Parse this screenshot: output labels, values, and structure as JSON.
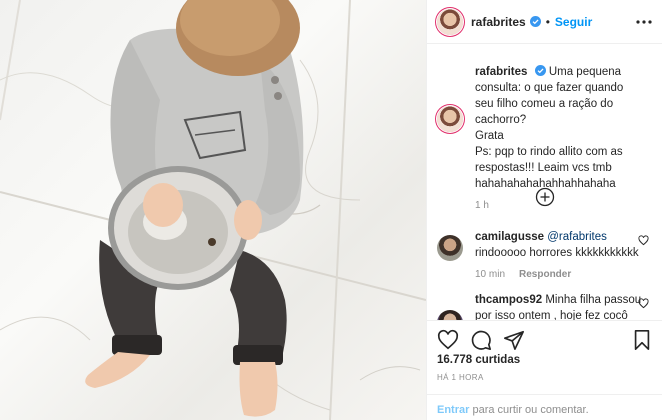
{
  "post": {
    "username": "rafabrites",
    "follow_label": "Seguir",
    "separator": "•",
    "photo_alt": "Criança sentada no chão de mármore com uma tigela de ração de cachorro"
  },
  "caption": {
    "username": "rafabrites",
    "text_line1": "Uma pequena consulta: o que fazer quando seu filho comeu a ração do cachorro?",
    "text_line2": "Grata",
    "text_line3": "Ps: pqp to rindo allito com as respostas!!! Leaim vcs tmb hahahahahahahhahhahaha",
    "time": "1 h"
  },
  "comments": [
    {
      "username": "camilagusse",
      "mention": "@rafabrites",
      "text": "rindooooo horrores kkkkkkkkkkk",
      "time": "10 min",
      "reply_label": "Responder"
    },
    {
      "username": "thcampos92",
      "text": "Minha filha passou por isso ontem , hoje fez cocô verde da"
    }
  ],
  "actions": {
    "likes": "16.778 curtidas",
    "posted_ago": "HÁ 1 HORA"
  },
  "comment_input": {
    "link_label": "Entrar",
    "text": "para curtir ou comentar."
  },
  "colors": {
    "accent": "#0095f6",
    "verified": "#3897f0",
    "muted": "#8e8e8e"
  }
}
